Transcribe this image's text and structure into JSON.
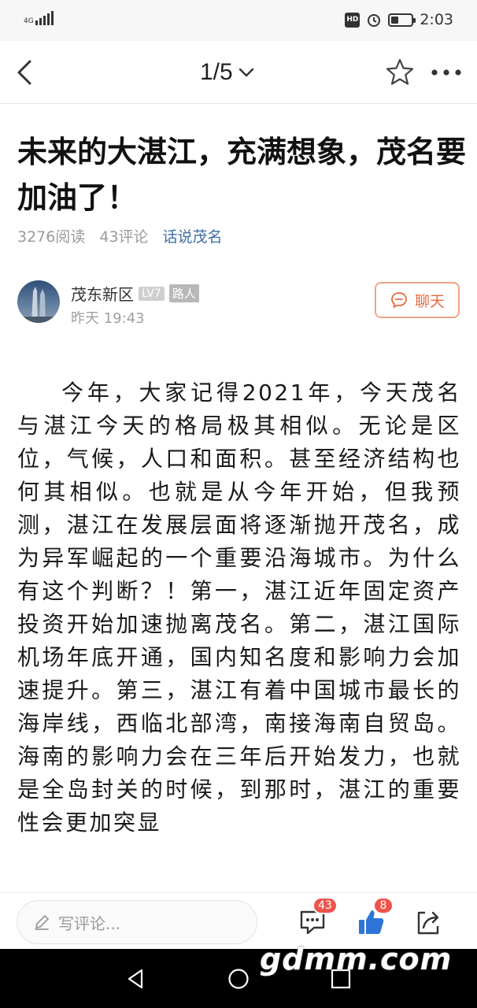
{
  "status_bar": {
    "network": "4G",
    "time": "2:03",
    "battery_level": 0.3,
    "hd_label": "HD"
  },
  "nav": {
    "page_indicator": "1/5"
  },
  "article": {
    "title": "未来的大湛江，充满想象，茂名要加油了！",
    "reads": "3276阅读",
    "comments": "43评论",
    "topic": "话说茂名",
    "author": {
      "name": "茂东新区",
      "level": "LV7",
      "role": "路人",
      "time": "昨天 19:43"
    },
    "chat_label": "聊天",
    "body": "今年，大家记得2021年，今天茂名与湛江今天的格局极其相似。无论是区位，气候，人口和面积。甚至经济结构也何其相似。也就是从今年开始，但我预测，湛江在发展层面将逐渐抛开茂名，成为异军崛起的一个重要沿海城市。为什么有这个判断？！第一，湛江近年固定资产投资开始加速抛离茂名。第二，湛江国际机场年底开通，国内知名度和影响力会加速提升。第三，湛江有着中国城市最长的海岸线，西临北部湾，南接海南自贸岛。海南的影响力会在三年后开始发力，也就是全岛封关的时候，到那时，湛江的重要性会更加突显"
  },
  "bottom_bar": {
    "comment_placeholder": "写评论...",
    "comment_count": "43",
    "like_count": "8"
  },
  "watermark": "gdmm.com",
  "colors": {
    "accent_orange": "#e8693e",
    "topic_blue": "#3e6ea5",
    "badge_red": "#f0534a",
    "like_blue": "#2f74d8"
  }
}
